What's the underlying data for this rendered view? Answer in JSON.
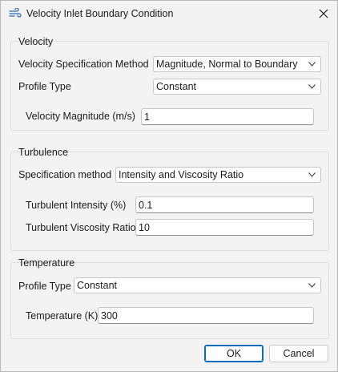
{
  "window": {
    "title": "Velocity Inlet Boundary Condition"
  },
  "velocity": {
    "group_title": "Velocity",
    "spec_method_label": "Velocity Specification Method",
    "spec_method_value": "Magnitude, Normal to Boundary",
    "profile_type_label": "Profile Type",
    "profile_type_value": "Constant",
    "magnitude_label": "Velocity Magnitude (m/s)",
    "magnitude_value": "1"
  },
  "turbulence": {
    "group_title": "Turbulence",
    "spec_method_label": "Specification method",
    "spec_method_value": "Intensity and Viscosity Ratio",
    "intensity_label": "Turbulent Intensity (%)",
    "intensity_value": "0.1",
    "viscosity_ratio_label": "Turbulent Viscosity Ratio",
    "viscosity_ratio_value": "10"
  },
  "temperature": {
    "group_title": "Temperature",
    "profile_type_label": "Profile Type",
    "profile_type_value": "Constant",
    "temperature_label": "Temperature (K)",
    "temperature_value": "300"
  },
  "buttons": {
    "ok": "OK",
    "cancel": "Cancel"
  },
  "icons": {
    "title": "wind-icon",
    "close": "close-icon",
    "dropdown": "chevron-down-icon"
  },
  "colors": {
    "accent": "#0f6cbd",
    "background": "#f3f3f3",
    "field": "#ffffff"
  }
}
